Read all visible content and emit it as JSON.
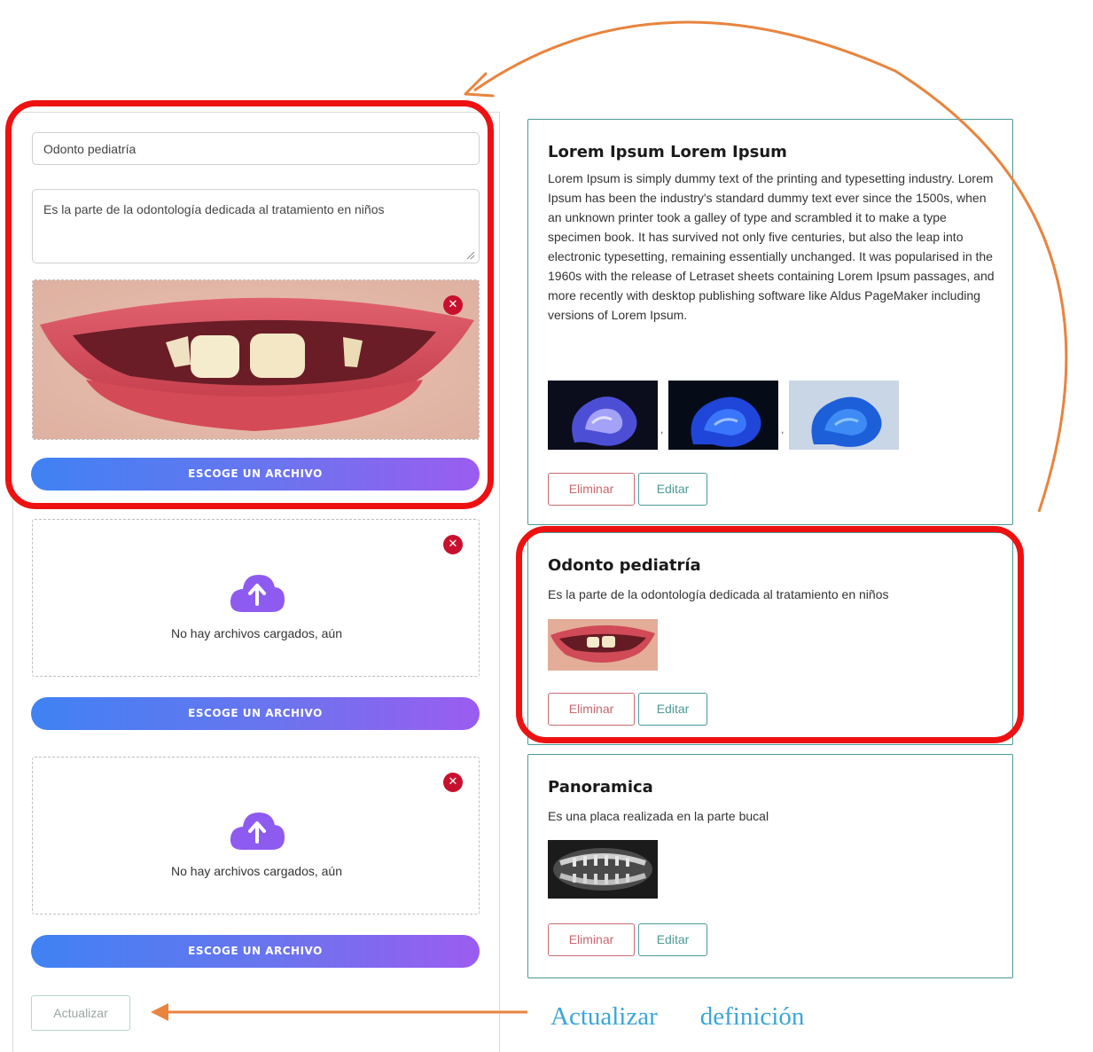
{
  "form": {
    "title_value": "Odonto pediatría",
    "description_value": "Es la parte de la odontología dedicada al tratamiento en niños",
    "slots": [
      {
        "has_image": true,
        "remove_icon": "close-circle-icon",
        "button_label": "ESCOGE UN ARCHIVO"
      },
      {
        "has_image": false,
        "empty_text": "No hay archivos cargados, aún",
        "upload_icon": "cloud-upload-icon",
        "remove_icon": "close-circle-icon",
        "button_label": "ESCOGE UN ARCHIVO"
      },
      {
        "has_image": false,
        "empty_text": "No hay archivos cargados, aún",
        "upload_icon": "cloud-upload-icon",
        "remove_icon": "close-circle-icon",
        "button_label": "ESCOGE UN ARCHIVO"
      }
    ],
    "update_label": "Actualizar"
  },
  "cards": [
    {
      "title": "Lorem Ipsum Lorem Ipsum",
      "body": "Lorem Ipsum is simply dummy text of the printing and typesetting industry. Lorem Ipsum has been the industry's standard dummy text ever since the 1500s, when an unknown printer took a galley of type and scrambled it to make a type specimen book. It has survived not only five centuries, but also the leap into electronic typesetting, remaining essentially unchanged. It was popularised in the 1960s with the release of Letraset sheets containing Lorem Ipsum passages, and more recently with desktop publishing software like Aldus PageMaker including versions of Lorem Ipsum.",
      "image_separator": ",",
      "delete_label": "Eliminar",
      "edit_label": "Editar"
    },
    {
      "title": "Odonto pediatría",
      "body": "Es la parte de la odontología dedicada al tratamiento en niños",
      "delete_label": "Eliminar",
      "edit_label": "Editar"
    },
    {
      "title": "Panoramica",
      "body": "Es una placa realizada en la parte bucal",
      "delete_label": "Eliminar",
      "edit_label": "Editar"
    }
  ],
  "annotations": {
    "caption_word1": "Actualizar",
    "caption_word2": "definición",
    "colors": {
      "outline": "#ee1111",
      "arrow": "#e8843e",
      "caption": "#3aa6d8"
    }
  },
  "colors": {
    "accent_teal": "#4b9a96",
    "danger": "#c9676f",
    "remove_red": "#c8102e",
    "upload_purple": "#8e5bf0",
    "button_gradient_start": "#3f82f3",
    "button_gradient_end": "#9b5cf0"
  }
}
